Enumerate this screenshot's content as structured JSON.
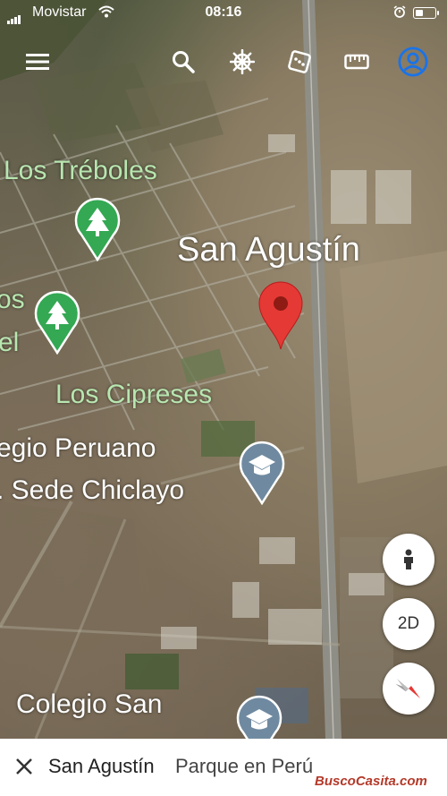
{
  "status": {
    "carrier": "Movistar",
    "time": "08:16"
  },
  "toolbar": {
    "menu_icon": "menu-icon",
    "search_icon": "search-icon",
    "voyager_icon": "ship-wheel-icon",
    "random_icon": "dice-icon",
    "measure_icon": "ruler-icon",
    "account_icon": "account-icon"
  },
  "map": {
    "labels": {
      "los_treboles": "Los Tréboles",
      "san_agustin": "San Agustín",
      "left_partial_1": "os",
      "left_partial_2": "el",
      "los_cipreses": "Los Cipreses",
      "colegio_line1": "egio Peruano",
      "colegio_line2": ". Sede Chiclayo",
      "colegio_san": "Colegio San"
    }
  },
  "controls": {
    "pegman_icon": "person-icon",
    "mode_label": "2D",
    "compass_icon": "compass-icon"
  },
  "sheet": {
    "title": "San Agustín",
    "subtitle": "Parque en Perú"
  },
  "watermark": "BuscoCasita.com",
  "colors": {
    "pin_red": "#e53935",
    "park_green": "#34a853",
    "school_gray": "#6f8aa0",
    "account_blue": "#1a73e8"
  }
}
